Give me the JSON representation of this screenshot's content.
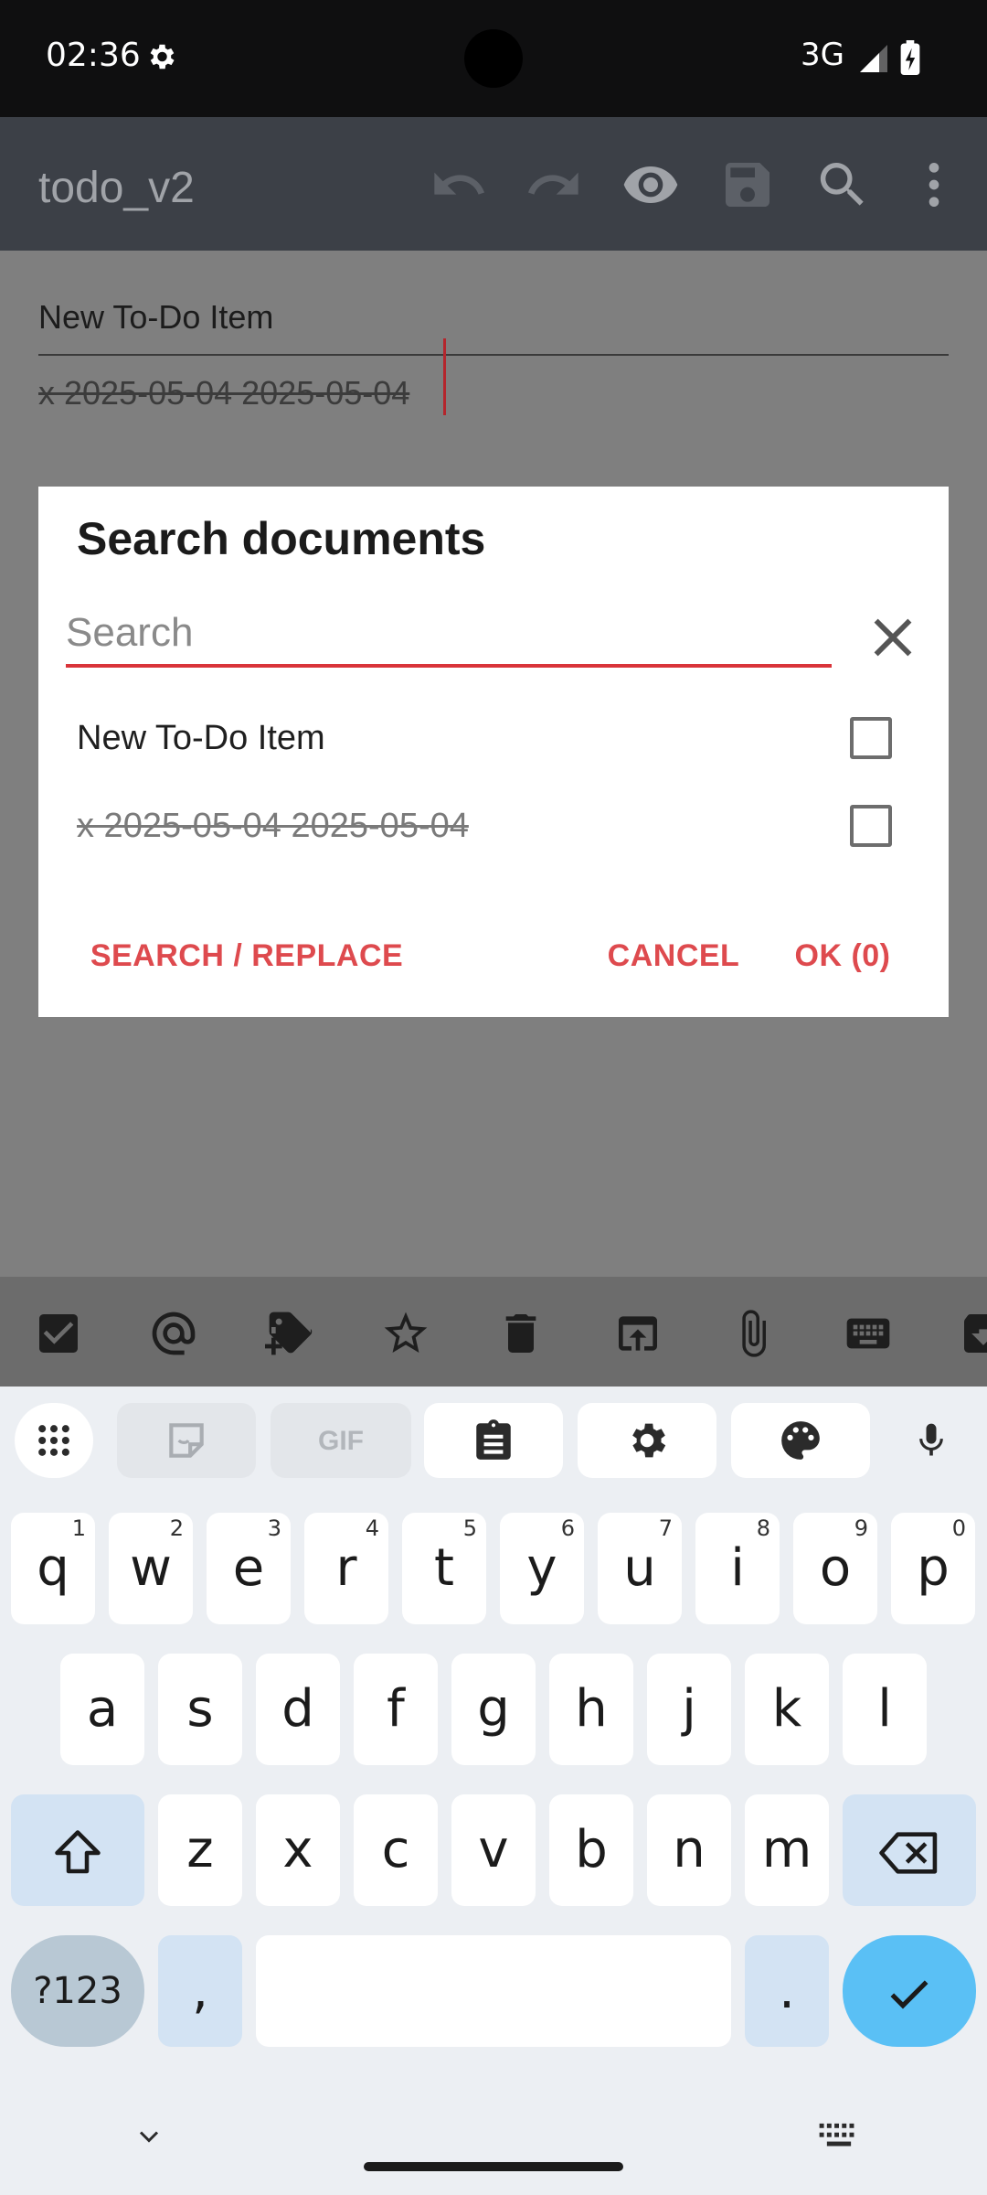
{
  "status_bar": {
    "time": "02:36",
    "network": "3G"
  },
  "app_bar": {
    "title": "todo_v2"
  },
  "editor": {
    "title": "New To-Do Item",
    "line": "x 2025-05-04 2025-05-04"
  },
  "dialog": {
    "title": "Search documents",
    "search_placeholder": "Search",
    "search_value": "",
    "items": [
      {
        "label": "New To-Do Item",
        "checked": false
      },
      {
        "label": "x 2025-05-04 2025-05-04",
        "checked": false
      }
    ],
    "buttons": {
      "search_replace": "SEARCH / REPLACE",
      "cancel": "CANCEL",
      "ok": "OK (0)"
    }
  },
  "keyboard": {
    "row1": [
      {
        "key": "q",
        "hint": "1"
      },
      {
        "key": "w",
        "hint": "2"
      },
      {
        "key": "e",
        "hint": "3"
      },
      {
        "key": "r",
        "hint": "4"
      },
      {
        "key": "t",
        "hint": "5"
      },
      {
        "key": "y",
        "hint": "6"
      },
      {
        "key": "u",
        "hint": "7"
      },
      {
        "key": "i",
        "hint": "8"
      },
      {
        "key": "o",
        "hint": "9"
      },
      {
        "key": "p",
        "hint": "0"
      }
    ],
    "row2": [
      "a",
      "s",
      "d",
      "f",
      "g",
      "h",
      "j",
      "k",
      "l"
    ],
    "row3": [
      "z",
      "x",
      "c",
      "v",
      "b",
      "n",
      "m"
    ],
    "sym_label": "?123",
    "comma": ",",
    "period": ".",
    "gif_label": "GIF"
  },
  "colors": {
    "accent": "#de4a4e",
    "keyboard_bg": "#eceff3",
    "enter_key": "#5ac0f5"
  }
}
